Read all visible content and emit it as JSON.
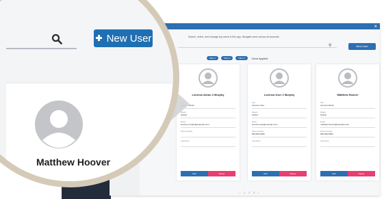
{
  "magnifier": {
    "new_user_label": "New User",
    "featured_user_name": "Matthew Hoover"
  },
  "app": {
    "search_hint": "Search, select, and manage any users in this app. Navigate users across all accounts",
    "new_user_label": "New User",
    "filters": [
      "Filter 1",
      "Filter 2",
      "Filter 3"
    ],
    "filter_label": "Clear Applied",
    "cards": [
      {
        "name": "Lorenzo Anton 2 Murphy",
        "fields": [
          {
            "label": "Title",
            "value": "Account Admin"
          },
          {
            "label": "Region",
            "value": "Global"
          },
          {
            "label": "Email",
            "value": "lorenzo.murphy@example.com"
          },
          {
            "label": "Phone Number",
            "value": ""
          },
          {
            "label": "Last Active",
            "value": ""
          }
        ],
        "btn_primary": "Edit",
        "btn_secondary": "Delete"
      },
      {
        "name": "Lorenzo User 2 Murphy",
        "fields": [
          {
            "label": "Title",
            "value": "Account User"
          },
          {
            "label": "Region",
            "value": "Global"
          },
          {
            "label": "Email",
            "value": "lorenzo.user@example.com"
          },
          {
            "label": "Phone Number",
            "value": "555-555-5555"
          },
          {
            "label": "Last Active",
            "value": ""
          }
        ],
        "btn_primary": "Edit",
        "btn_secondary": "Delete"
      },
      {
        "name": "Matthew Hoover",
        "fields": [
          {
            "label": "Title",
            "value": "Account Admin"
          },
          {
            "label": "Region",
            "value": "Global"
          },
          {
            "label": "Email",
            "value": "matthew.hoover@example.com"
          },
          {
            "label": "Phone Number",
            "value": "555-555-5555"
          },
          {
            "label": "Last Active",
            "value": ""
          }
        ],
        "btn_primary": "Edit",
        "btn_secondary": "Delete"
      }
    ],
    "pager": [
      "‹",
      "1",
      "2",
      "3",
      "›"
    ]
  },
  "colors": {
    "primary_blue": "#1f6fb2",
    "danger_pink": "#e83e72",
    "lens_ring": "#d4cab7",
    "sidebar_dark": "#232c3b"
  },
  "icons": [
    "search-icon",
    "user-plus-icon",
    "avatar-placeholder-icon",
    "close-icon",
    "arrow-pointer-icon"
  ]
}
